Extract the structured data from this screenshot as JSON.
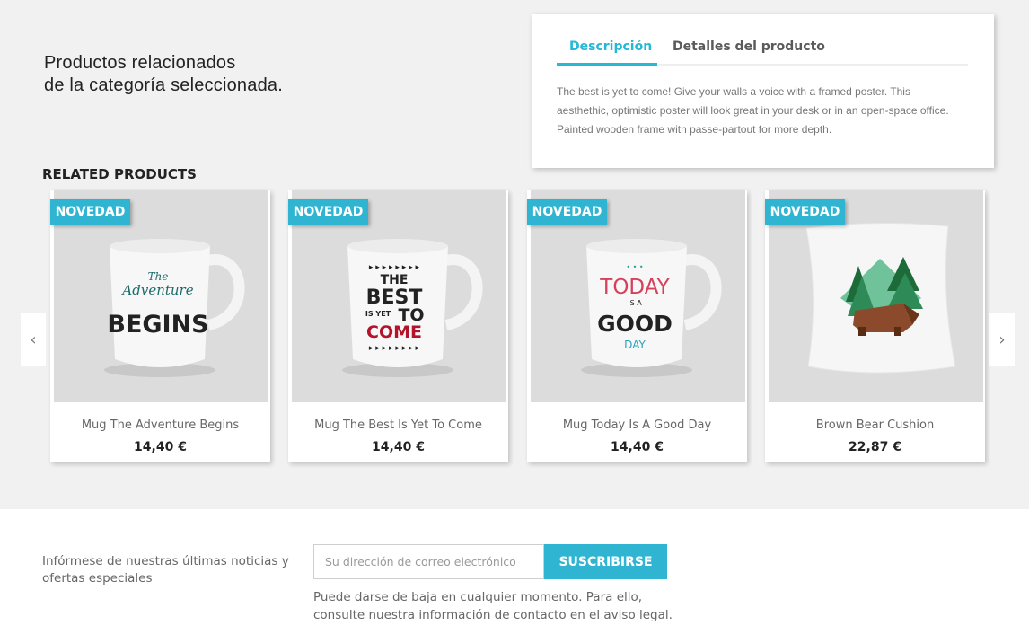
{
  "intro": {
    "line1": "Productos relacionados",
    "line2": "de la categoría seleccionada."
  },
  "product_tabs": {
    "tabs": [
      {
        "label": "Descripción",
        "active": true
      },
      {
        "label": "Detalles del producto",
        "active": false
      }
    ],
    "description": "The best is yet to come! Give your walls a voice with a framed poster. This aesthethic, optimistic poster will look great in your desk or in an open-space office. Painted wooden frame with passe-partout for more depth."
  },
  "related": {
    "title": "RELATED PRODUCTS",
    "prev_icon": "chevron-left-icon",
    "next_icon": "chevron-right-icon",
    "products": [
      {
        "badge": "NOVEDAD",
        "name": "Mug The Adventure Begins",
        "price": "14,40 €",
        "art": {
          "l1": "The",
          "l2": "Adventure",
          "l3": "BEGINS"
        }
      },
      {
        "badge": "NOVEDAD",
        "name": "Mug The Best Is Yet To Come",
        "price": "14,40 €",
        "art": {
          "l1": "THE",
          "l2": "BEST",
          "l3": "IS YET",
          "l4": "TO",
          "l5": "COME"
        }
      },
      {
        "badge": "NOVEDAD",
        "name": "Mug Today Is A Good Day",
        "price": "14,40 €",
        "art": {
          "l1": "TODAY",
          "l2": "IS A",
          "l3": "GOOD",
          "l4": "DAY"
        }
      },
      {
        "badge": "NOVEDAD",
        "name": "Brown Bear Cushion",
        "price": "22,87 €"
      }
    ]
  },
  "newsletter": {
    "text": "Infórmese de nuestras últimas noticias y ofertas especiales",
    "placeholder": "Su dirección de correo electrónico",
    "button": "SUSCRIBIRSE",
    "note": "Puede darse de baja en cualquier momento. Para ello, consulte nuestra información de contacto en el aviso legal."
  },
  "colors": {
    "accent": "#2fb5d2",
    "background": "#f1f1f1"
  }
}
